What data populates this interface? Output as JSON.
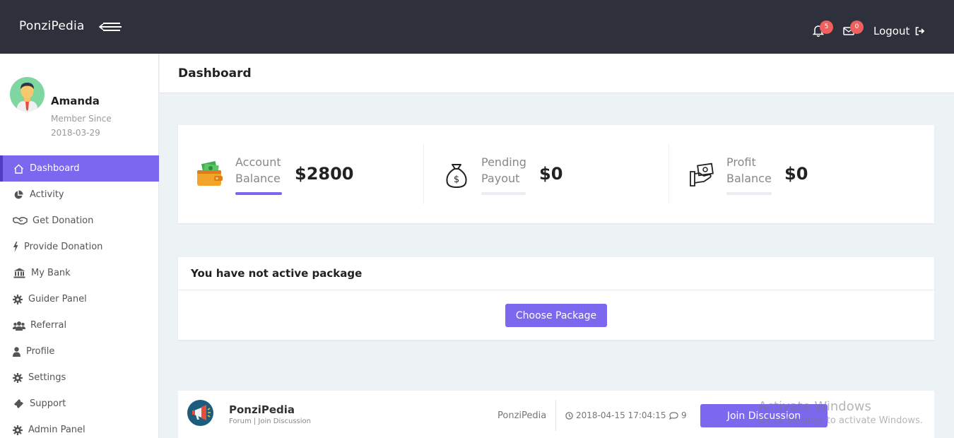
{
  "app": {
    "brand": "PonziPedia"
  },
  "topbar": {
    "notifications_count": "5",
    "messages_count": "0",
    "logout_label": "Logout"
  },
  "user": {
    "name": "Amanda",
    "member_since_label": "Member Since",
    "member_since_date": "2018-03-29"
  },
  "sidebar": {
    "items": [
      {
        "label": "Dashboard",
        "icon": "home-icon",
        "active": true
      },
      {
        "label": "Activity",
        "icon": "pie-chart-icon"
      },
      {
        "label": "Get Donation",
        "icon": "handshake-icon"
      },
      {
        "label": "Provide Donation",
        "icon": "bolt-icon"
      },
      {
        "label": "My Bank",
        "icon": "bank-icon"
      },
      {
        "label": "Guider Panel",
        "icon": "gear-icon"
      },
      {
        "label": "Referral",
        "icon": "users-icon"
      },
      {
        "label": "Profile",
        "icon": "user-icon"
      },
      {
        "label": "Settings",
        "icon": "gear-icon"
      },
      {
        "label": "Support",
        "icon": "ticket-icon"
      },
      {
        "label": "Admin Panel",
        "icon": "gear-icon"
      }
    ]
  },
  "page": {
    "title": "Dashboard"
  },
  "stats": [
    {
      "label_line1": "Account",
      "label_line2": "Balance",
      "value": "$2800",
      "icon": "wallet-icon",
      "progress": 1.0
    },
    {
      "label_line1": "Pending",
      "label_line2": "Payout",
      "value": "$0",
      "icon": "money-bag-icon",
      "progress": 0
    },
    {
      "label_line1": "Profit",
      "label_line2": "Balance",
      "value": "$0",
      "icon": "cash-hand-icon",
      "progress": 0
    }
  ],
  "package": {
    "title": "You have not active package",
    "button_label": "Choose Package"
  },
  "forum": {
    "name": "PonziPedia",
    "subtitle": "Forum | Join Discussion",
    "author": "PonziPedia",
    "datetime": "2018-04-15 17:04:15",
    "comments": "9",
    "button_label": "Join Discussion"
  },
  "watermark": {
    "title": "Activate Windows",
    "subtitle": "Go to Settings to activate Windows."
  },
  "colors": {
    "topbar": "#2e303b",
    "accent": "#7b68ee",
    "badge": "#f0605e",
    "background": "#edf2f5"
  }
}
